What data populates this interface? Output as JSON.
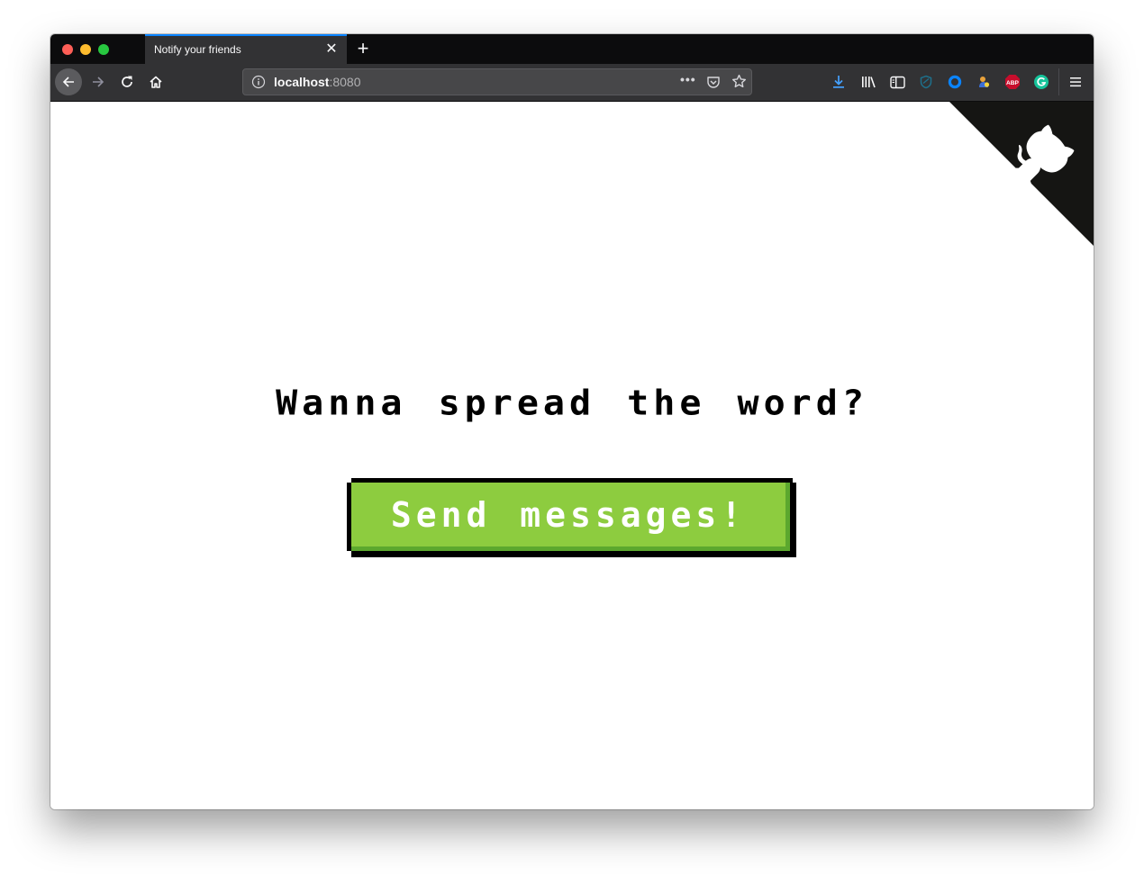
{
  "window": {
    "traffic_lights": [
      "close",
      "minimize",
      "zoom"
    ]
  },
  "tabs": [
    {
      "title": "Notify your friends",
      "active": true,
      "close_icon": "close-icon"
    }
  ],
  "tabstrip": {
    "new_tab_icon": "plus-icon"
  },
  "toolbar": {
    "back_icon": "arrow-left-icon",
    "forward_icon": "arrow-right-icon",
    "reload_icon": "reload-icon",
    "home_icon": "home-icon",
    "url": {
      "host": "localhost",
      "port": ":8080",
      "info_icon": "info-icon",
      "page_actions": [
        "more-icon",
        "pocket-icon",
        "star-icon"
      ]
    },
    "extensions": [
      {
        "name": "downloads",
        "icon": "download-icon",
        "color": "#45a1ff"
      },
      {
        "name": "library",
        "icon": "library-icon"
      },
      {
        "name": "sidebar",
        "icon": "sidebar-icon"
      },
      {
        "name": "privacy-badger",
        "icon": "shield-icon",
        "color": "#1e6f8a"
      },
      {
        "name": "blue-ring",
        "icon": "circle-icon",
        "color": "#0a84ff"
      },
      {
        "name": "colorful-ext",
        "icon": "sticker-icon"
      },
      {
        "name": "adblock-plus",
        "icon": "abp-icon",
        "label": "ABP",
        "color": "#c70d2c"
      },
      {
        "name": "grammarly",
        "icon": "grammarly-icon",
        "label": "G",
        "color": "#15c39a"
      }
    ],
    "menu_icon": "hamburger-menu-icon"
  },
  "page": {
    "headline": "Wanna spread the word?",
    "cta_label": "Send messages!",
    "cta_color": "#8dcc3f",
    "github_corner_icon": "octocat-icon"
  }
}
